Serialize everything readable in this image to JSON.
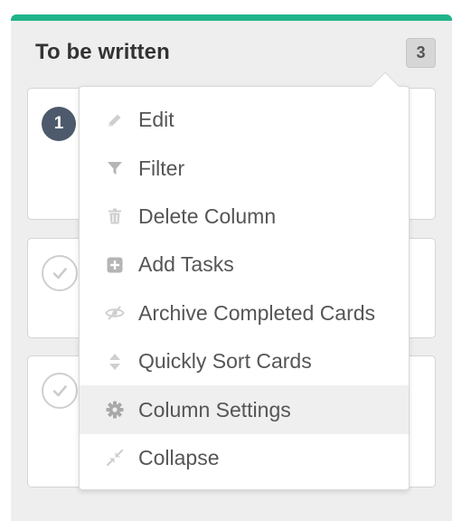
{
  "column": {
    "title": "To be written",
    "count": "3",
    "accent_color": "#21b38a"
  },
  "cards": [
    {
      "number": "1",
      "state": "numbered"
    },
    {
      "state": "check"
    },
    {
      "state": "check"
    }
  ],
  "menu": {
    "items": [
      {
        "label": "Edit",
        "icon": "pencil-icon"
      },
      {
        "label": "Filter",
        "icon": "filter-icon"
      },
      {
        "label": "Delete Column",
        "icon": "trash-icon"
      },
      {
        "label": "Add Tasks",
        "icon": "plus-square-icon"
      },
      {
        "label": "Archive Completed Cards",
        "icon": "eye-slash-icon"
      },
      {
        "label": "Quickly Sort Cards",
        "icon": "sort-icon"
      },
      {
        "label": "Column Settings",
        "icon": "gear-icon",
        "highlighted": true
      },
      {
        "label": "Collapse",
        "icon": "collapse-icon"
      }
    ]
  }
}
